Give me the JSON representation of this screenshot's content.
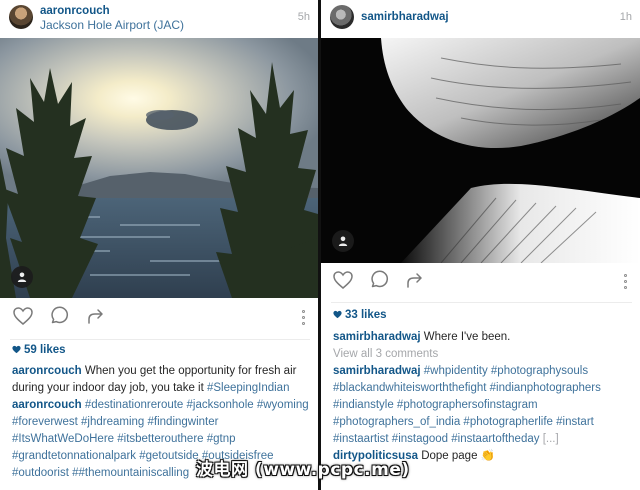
{
  "left_post": {
    "username": "aaronrcouch",
    "location": "Jackson Hole Airport (JAC)",
    "time_ago": "5h",
    "photo_icon": "usertag-person-icon",
    "actions": [
      "heart-icon",
      "comment-bubble-icon",
      "share-arrow-icon",
      "more-dots-icon"
    ],
    "likes": "59 likes",
    "caption_user": "aaronrcouch",
    "caption_text": " When you get the opportunity for fresh air during your indoor day job, you take it ",
    "caption_tag": "#SleepingIndian",
    "comment_user": "aaronrcouch",
    "comment_tags": " #destinationreroute #jacksonhole #wyoming #foreverwest #jhdreaming #findingwinter #ItsWhatWeDoHere #itsbetterouthere #gtnp #grandtetonnationalpark #getoutside #outsideisfree #outdoorist ##themountainiscalling"
  },
  "right_post": {
    "username": "samirbharadwaj",
    "time_ago": "1h",
    "photo_icon": "usertag-person-icon",
    "actions": [
      "heart-icon",
      "comment-bubble-icon",
      "share-arrow-icon",
      "more-dots-icon"
    ],
    "likes": "33 likes",
    "caption_user": "samirbharadwaj",
    "caption_text": " Where I've been.",
    "view_comments": "View all 3 comments",
    "comment1_user": "samirbharadwaj",
    "comment1_tags": " #whpidentity #photographysouls #blackandwhiteisworththefight #indianphotographers #indianstyle #photographersofinstagram #photographers_of_india #photographerlife #instart #instaartist #instagood #instaartoftheday",
    "comment1_more": " [...]",
    "comment2_user": "dirtypoliticsusa",
    "comment2_text": " Dope page 👏"
  },
  "watermark": "波电网 (www.pcpc.me)",
  "colors": {
    "username": "#125688",
    "hashtag": "#3f729b",
    "muted": "#a5a7aa",
    "divider": "#111111"
  }
}
